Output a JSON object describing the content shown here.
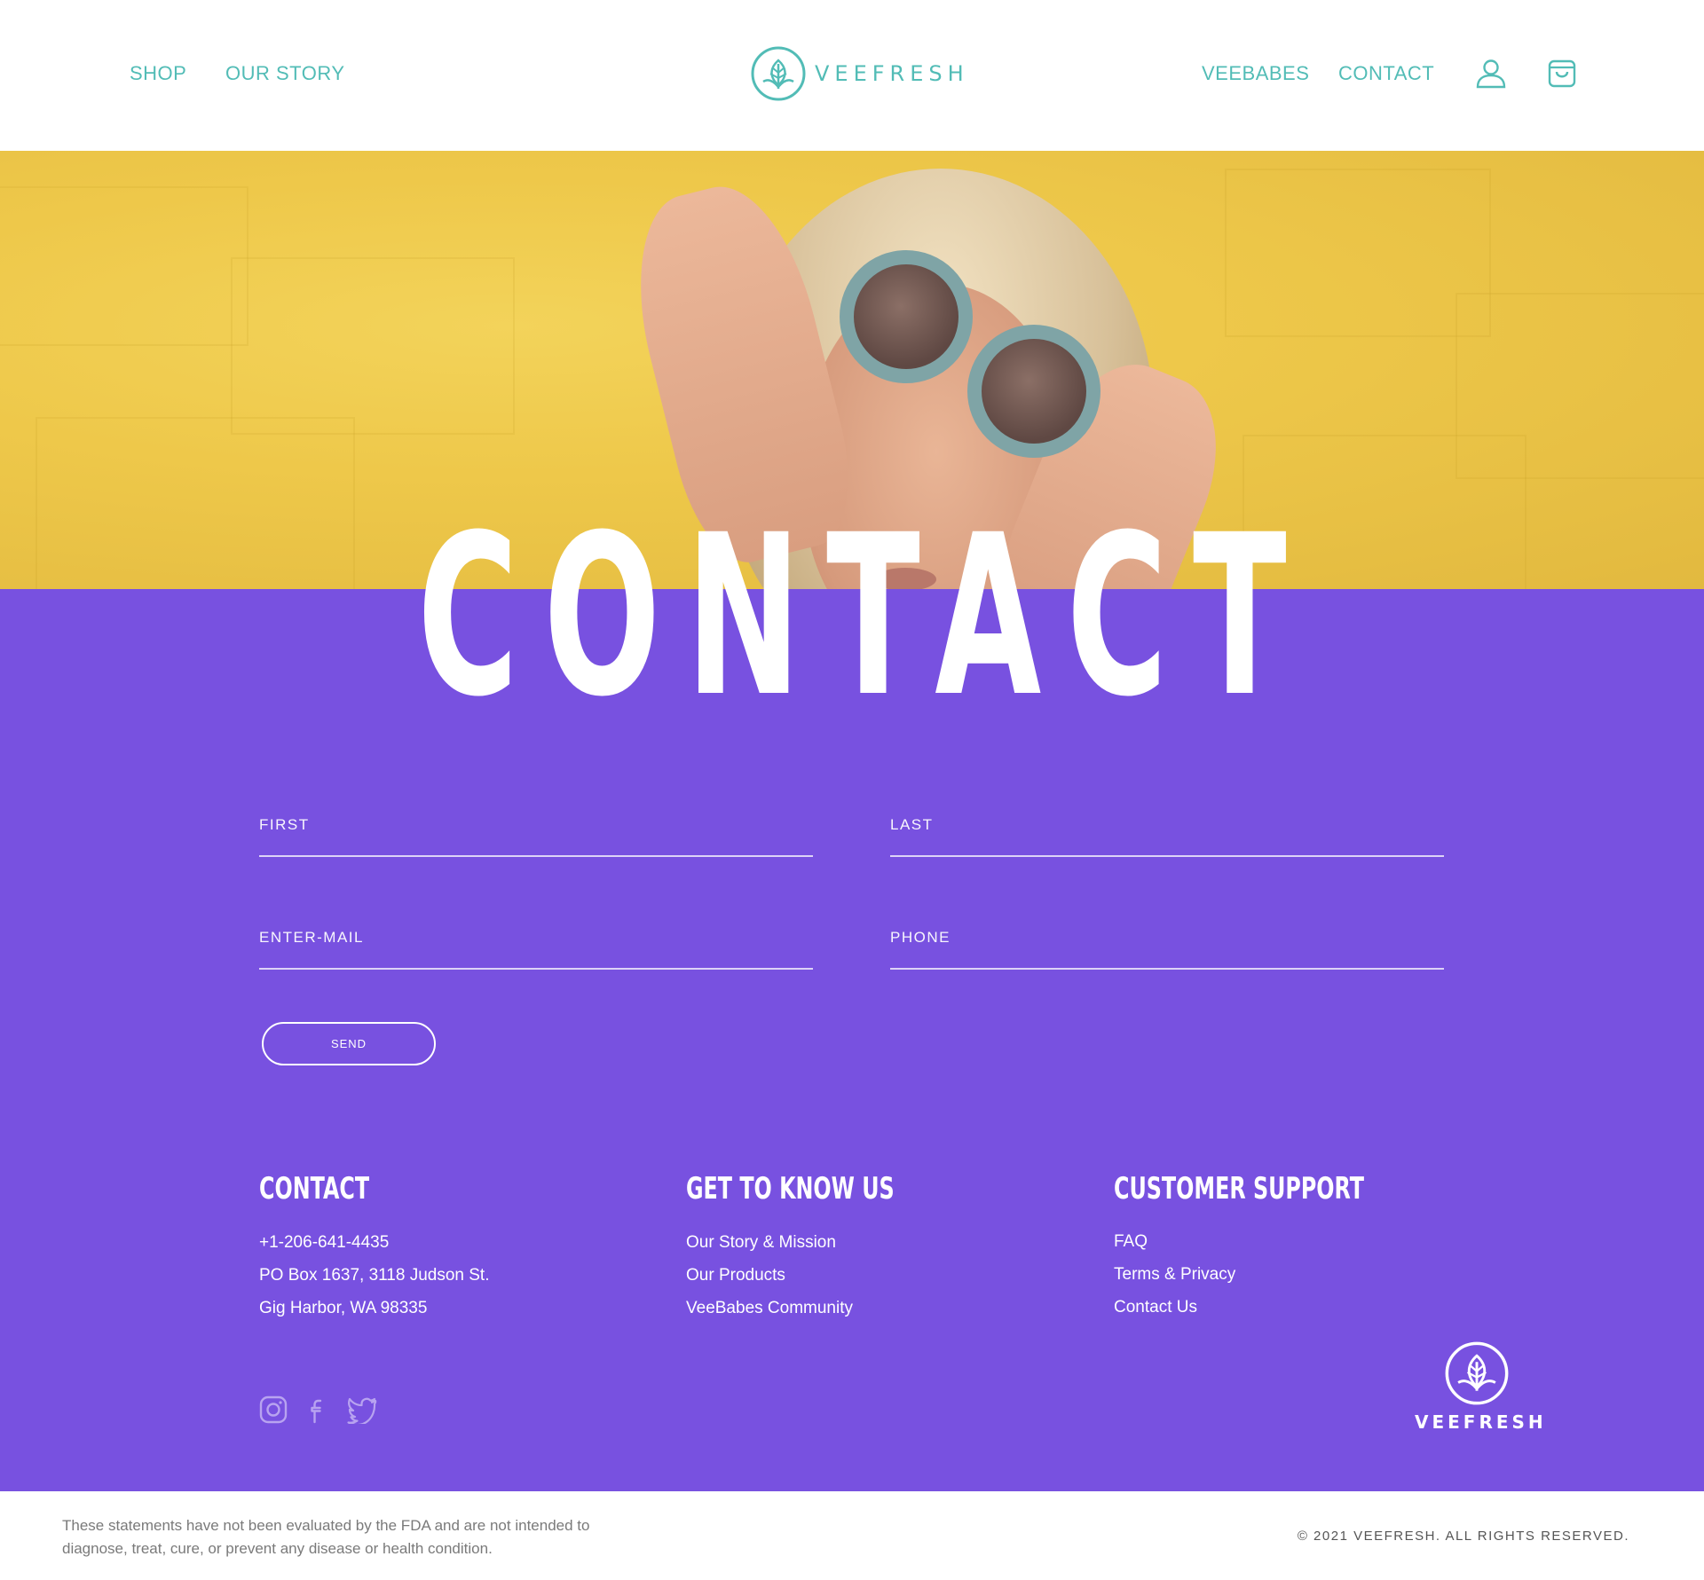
{
  "header": {
    "nav_left": [
      "SHOP",
      "OUR STORY"
    ],
    "nav_right": [
      "VEEBABES",
      "CONTACT"
    ],
    "logo_text": "VEEFRESH",
    "icons": [
      "user-icon",
      "cart-icon"
    ]
  },
  "hero": {
    "title": "CONTACT"
  },
  "form": {
    "first_placeholder": "FIRST",
    "last_placeholder": "LAST",
    "email_placeholder": "ENTER-MAIL",
    "phone_placeholder": "PHONE",
    "send_label": "SEND"
  },
  "footer": {
    "contact": {
      "heading": "CONTACT",
      "lines": [
        "+1-206-641-4435",
        "PO Box 1637, 3118 Judson St.",
        "Gig Harbor, WA 98335"
      ]
    },
    "get_to_know": {
      "heading": "GET TO KNOW US",
      "links": [
        "Our Story & Mission",
        "Our Products",
        "VeeBabes Community"
      ]
    },
    "support": {
      "heading": "CUSTOMER SUPPORT",
      "links": [
        "FAQ",
        "Terms & Privacy",
        "Contact Us"
      ]
    },
    "social": [
      "instagram-icon",
      "facebook-icon",
      "twitter-icon"
    ],
    "logo_text": "VEEFRESH"
  },
  "bottom": {
    "disclaimer": "These statements have not been evaluated by the FDA and are not intended to diagnose, treat, cure, or prevent any disease or health condition.",
    "copyright": "© 2021 VEEFRESH. ALL RIGHTS RESERVED."
  },
  "colors": {
    "teal": "#52bcb6",
    "purple": "#7851e0",
    "hero_yellow": "#eec84a",
    "white": "#ffffff"
  }
}
